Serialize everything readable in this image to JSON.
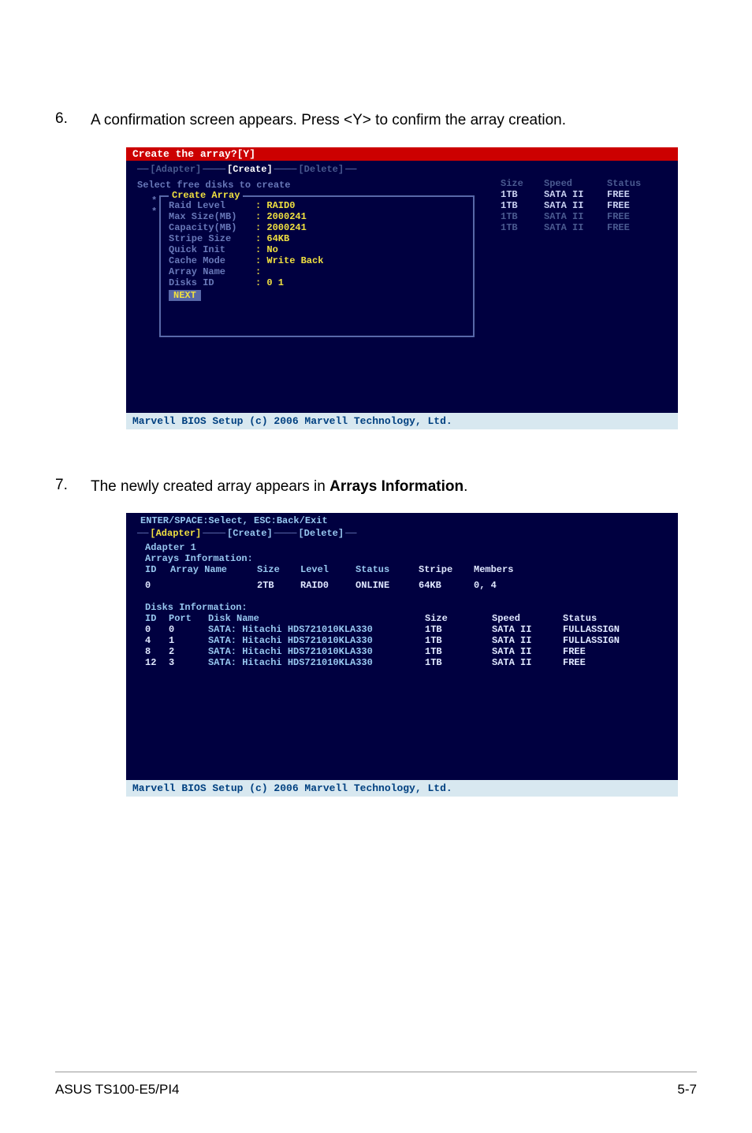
{
  "page": {
    "footer_left": "ASUS TS100-E5/PI4",
    "footer_right": "5-7"
  },
  "step6": {
    "num": "6.",
    "text": "A confirmation screen appears. Press <Y> to confirm the array creation."
  },
  "step7": {
    "num": "7.",
    "text_prefix": "The newly created array appears in ",
    "text_bold": "Arrays Information",
    "text_suffix": "."
  },
  "bios_footer": "Marvell BIOS Setup (c) 2006 Marvell Technology, Ltd.",
  "bios1": {
    "titlebar": "Create the array?[Y]",
    "tab_adapter": "[Adapter]",
    "tab_create": "[Create]",
    "tab_delete": "[Delete]",
    "subheader": "Select free disks to create",
    "panel_title": "Create Array",
    "rows": [
      {
        "label": "Raid Level",
        "value": ": RAID0"
      },
      {
        "label": "Max Size(MB)",
        "value": ": 2000241"
      },
      {
        "label": "Capacity(MB)",
        "value": ": 2000241"
      },
      {
        "label": "Stripe Size",
        "value": ": 64KB"
      },
      {
        "label": "Quick Init",
        "value": ": No"
      },
      {
        "label": "Cache Mode",
        "value": ": Write Back"
      },
      {
        "label": "Array Name",
        "value": ":"
      },
      {
        "label": "Disks ID",
        "value": ": 0 1"
      }
    ],
    "next": "NEXT",
    "right": {
      "headers": {
        "size": "Size",
        "speed": "Speed",
        "status": "Status"
      },
      "rows": [
        {
          "size": "1TB",
          "speed": "SATA II",
          "status": "FREE",
          "bright": true
        },
        {
          "size": "1TB",
          "speed": "SATA II",
          "status": "FREE",
          "bright": true
        },
        {
          "size": "1TB",
          "speed": "SATA II",
          "status": "FREE",
          "bright": false
        },
        {
          "size": "1TB",
          "speed": "SATA II",
          "status": "FREE",
          "bright": false
        }
      ]
    }
  },
  "bios2": {
    "pretitle": "ENTER/SPACE:Select, ESC:Back/Exit",
    "tab_adapter": "[Adapter]",
    "tab_create": "[Create]",
    "tab_delete": "[Delete]",
    "adapter": "Adapter 1",
    "arrays_label": "Arrays Information:",
    "arrays_headers": {
      "id": "ID",
      "name": "Array Name",
      "size": "Size",
      "level": "Level",
      "status": "Status",
      "stripe_label": "Stripe",
      "members": "Members"
    },
    "arrays_row": {
      "id": "0",
      "name": "",
      "size": "2TB",
      "level": "RAID0",
      "status": "ONLINE",
      "stripe": "64KB",
      "members": "0, 4"
    },
    "disks_label": "Disks Information:",
    "disks_headers": {
      "id": "ID",
      "port": "Port",
      "dname": "Disk Name",
      "size": "Size",
      "speed": "Speed",
      "status": "Status"
    },
    "disks": [
      {
        "id": "0",
        "port": "0",
        "name": "SATA: Hitachi HDS721010KLA330",
        "size": "1TB",
        "speed": "SATA II",
        "status": "FULLASSIGN"
      },
      {
        "id": "4",
        "port": "1",
        "name": "SATA: Hitachi HDS721010KLA330",
        "size": "1TB",
        "speed": "SATA II",
        "status": "FULLASSIGN"
      },
      {
        "id": "8",
        "port": "2",
        "name": "SATA: Hitachi HDS721010KLA330",
        "size": "1TB",
        "speed": "SATA II",
        "status": "FREE"
      },
      {
        "id": "12",
        "port": "3",
        "name": "SATA: Hitachi HDS721010KLA330",
        "size": "1TB",
        "speed": "SATA II",
        "status": "FREE"
      }
    ]
  }
}
